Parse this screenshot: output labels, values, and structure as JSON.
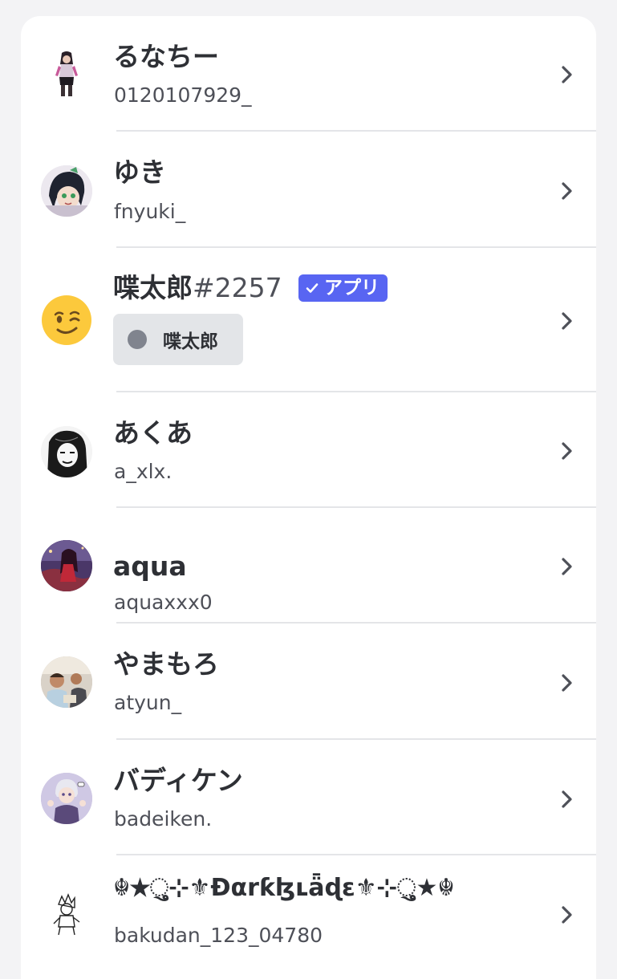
{
  "members": [
    {
      "display_name": "るなちー",
      "username": "0120107929_",
      "avatar": "avatar-anime-figure-icon"
    },
    {
      "display_name": "ゆき",
      "username": "fnyuki_",
      "avatar": "avatar-anime-girl-icon"
    },
    {
      "display_name": "喋太郎",
      "discriminator": "#2257",
      "badge_label": "アプリ",
      "badge_icon": "check-icon",
      "app_name": "喋太郎",
      "avatar": "winking-face-emoji-icon",
      "status_dot_color": "#80848e"
    },
    {
      "display_name": "あくあ",
      "username": "a_xlx.",
      "avatar": "avatar-manga-portrait-icon"
    },
    {
      "display_name": "aqua",
      "username": "aquaxxx0",
      "avatar": "avatar-anime-scene-icon"
    },
    {
      "display_name": "やまもろ",
      "username": "atyun_",
      "avatar": "avatar-photo-icon"
    },
    {
      "display_name": "バディケン",
      "username": "badeiken.",
      "avatar": "avatar-chibi-character-icon"
    },
    {
      "display_name": "☬★ુ⊹⚜Ɖαrƙɮʟǟɖɛ⚜⊹ુ★☬",
      "username": "bakudan_123_04780",
      "avatar": "avatar-sketch-character-icon"
    }
  ],
  "colors": {
    "accent": "#5865f2",
    "name_text": "#2e3035",
    "secondary_text": "#4e5058",
    "divider": "#e4e5e8",
    "chip_bg": "#e3e5e8",
    "page_bg": "#f3f3f5",
    "panel_bg": "#ffffff"
  }
}
